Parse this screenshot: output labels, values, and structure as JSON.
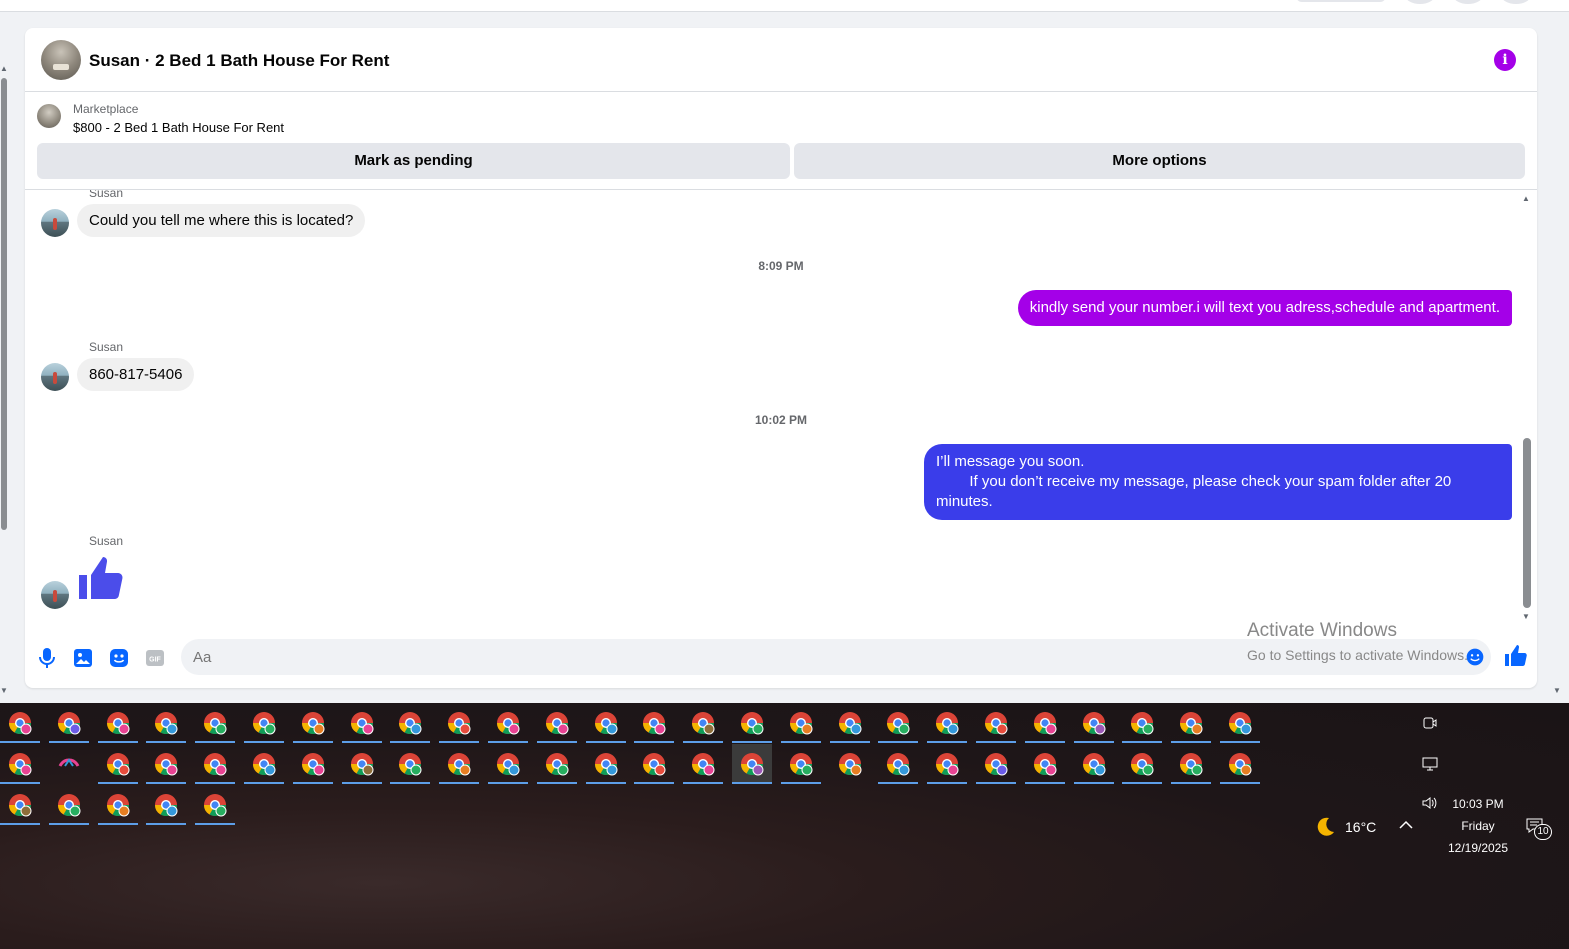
{
  "header": {
    "title": "Susan · 2 Bed 1 Bath House For Rent",
    "info_icon": "info-icon"
  },
  "listing": {
    "label": "Marketplace",
    "price_title": "$800 - 2 Bed 1 Bath House For Rent",
    "mark_pending_label": "Mark as pending",
    "more_options_label": "More options"
  },
  "messages": {
    "sender_name": "Susan",
    "msg1": "Could you tell me where this is located?",
    "ts1": "8:09 PM",
    "out1": "kindly send your number.i will text you adress,schedule and apartment.",
    "msg2": "860-817-5406",
    "ts2": "10:02 PM",
    "out2": "I’ll message you soon.\n        If you don’t receive my message, please check your spam folder after 20 minutes.",
    "like_icon": "thumbs-up-icon"
  },
  "composer": {
    "placeholder": "Aa",
    "icons": [
      "microphone-icon",
      "image-icon",
      "sticker-icon",
      "gif-icon",
      "emoji-icon",
      "thumbs-up-icon"
    ]
  },
  "watermark": {
    "line1": "Activate Windows",
    "line2": "Go to Settings to activate Windows."
  },
  "taskbar": {
    "temperature": "16°C",
    "time": "10:03 PM",
    "day": "Friday",
    "date": "12/19/2025",
    "notifications": "10",
    "colors": {
      "brand_purple": "#a400e8",
      "blue_bubble": "#3a3dea",
      "underline": "#5d9ee8"
    }
  }
}
